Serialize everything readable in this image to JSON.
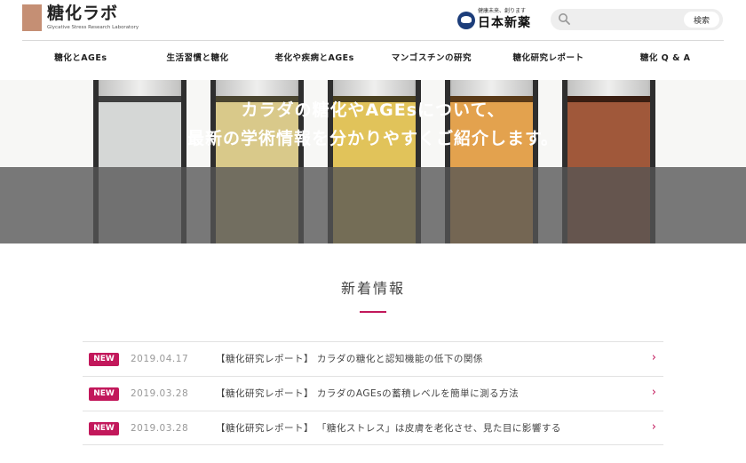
{
  "header": {
    "logo_title": "糖化ラボ",
    "logo_subtitle": "Glycative Stress Research Laboratory",
    "sponsor_tagline": "健康未来、創ります",
    "sponsor_name": "日本新薬",
    "search_placeholder": "",
    "search_button": "検索"
  },
  "nav": {
    "items": [
      {
        "label": "糖化とAGEs"
      },
      {
        "label": "生活習慣と糖化"
      },
      {
        "label": "老化や疾病とAGEs"
      },
      {
        "label": "マンゴスチンの研究"
      },
      {
        "label": "糖化研究レポート"
      },
      {
        "label": "糖化 Q & A"
      }
    ]
  },
  "hero": {
    "line1": "カラダの糖化やAGEsについて、",
    "line2": "最新の学術情報を分かりやすくご紹介します。"
  },
  "news": {
    "title": "新着情報",
    "items": [
      {
        "badge": "NEW",
        "date": "2019.04.17",
        "text": "【糖化研究レポート】 カラダの糖化と認知機能の低下の関係"
      },
      {
        "badge": "NEW",
        "date": "2019.03.28",
        "text": "【糖化研究レポート】 カラダのAGEsの蓄積レベルを簡単に測る方法"
      },
      {
        "badge": "NEW",
        "date": "2019.03.28",
        "text": "【糖化研究レポート】 「糖化ストレス」は皮膚を老化させ、見た目に影響する"
      }
    ]
  },
  "colors": {
    "accent": "#c2185b",
    "logo": "#c58f74",
    "sponsor_blue": "#1c3d7a"
  }
}
